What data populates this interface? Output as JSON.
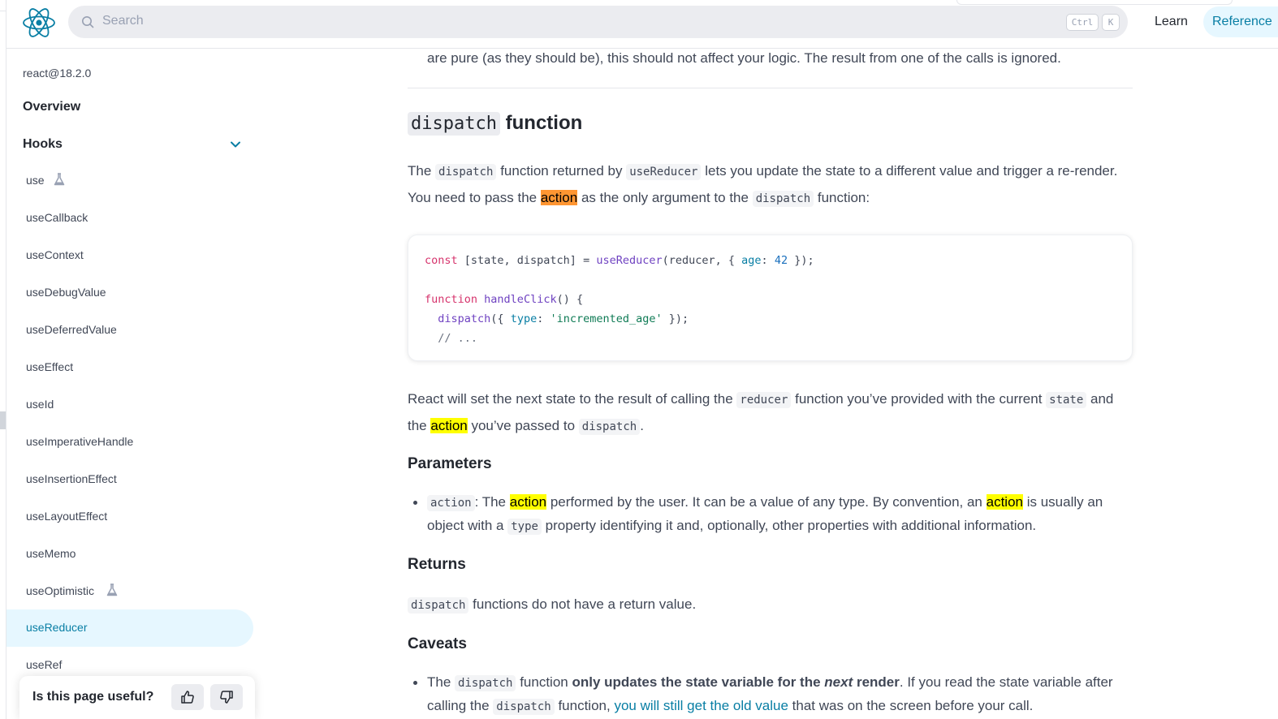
{
  "header": {
    "search_placeholder": "Search",
    "kbd_ctrl": "Ctrl",
    "kbd_k": "K",
    "nav_learn": "Learn",
    "nav_reference": "Reference",
    "accent": "#087ea4"
  },
  "sidebar": {
    "version": "react@18.2.0",
    "overview": "Overview",
    "section": "Hooks",
    "items": [
      {
        "label": "use",
        "badge": "flask-icon"
      },
      {
        "label": "useCallback"
      },
      {
        "label": "useContext"
      },
      {
        "label": "useDebugValue"
      },
      {
        "label": "useDeferredValue"
      },
      {
        "label": "useEffect"
      },
      {
        "label": "useId"
      },
      {
        "label": "useImperativeHandle"
      },
      {
        "label": "useInsertionEffect"
      },
      {
        "label": "useLayoutEffect"
      },
      {
        "label": "useMemo"
      },
      {
        "label": "useOptimistic",
        "badge": "flask-icon"
      },
      {
        "label": "useReducer",
        "active": true
      },
      {
        "label": "useRef"
      }
    ],
    "feedback_question": "Is this page useful?"
  },
  "main": {
    "prev_text": "are pure (as they should be), this should not affect your logic. The result from one of the calls is ignored.",
    "heading_code": "dispatch",
    "heading_text": "function",
    "intro": {
      "t1": "The ",
      "c1": "dispatch",
      "t2": " function returned by ",
      "c2": "useReducer",
      "t3": " lets you update the state to a different value and trigger a re-render. You need to pass the ",
      "hl": "action",
      "t4": " as the only argument to the ",
      "c3": "dispatch",
      "t5": " function:"
    },
    "code": {
      "l1_kw": "const",
      "l1_a": " [state, dispatch] = ",
      "l1_fn": "useReducer",
      "l1_b": "(reducer, { ",
      "l1_prop": "age",
      "l1_c": ": ",
      "l1_num": "42",
      "l1_d": " });",
      "l3_kw": "function",
      "l3_fn": "handleClick",
      "l3_a": "() {",
      "l4_fn": "dispatch",
      "l4_a": "({ ",
      "l4_prop": "type",
      "l4_b": ": ",
      "l4_str": "'incremented_age'",
      "l4_c": " });",
      "l5_cm": "// ..."
    },
    "react_sets": {
      "t1": "React will set the next state to the result of calling the ",
      "c1": "reducer",
      "t2": " function you’ve provided with the current ",
      "c2": "state",
      "t3": " and the ",
      "hl": "action",
      "t4": " you’ve passed to ",
      "c3": "dispatch",
      "t5": "."
    },
    "parameters_heading": "Parameters",
    "param": {
      "c1": "action",
      "t1": ": The ",
      "hl1": "action",
      "t2": " performed by the user. It can be a value of any type. By convention, an ",
      "hl2": "action",
      "t3": " is usually an object with a ",
      "c2": "type",
      "t4": " property identifying it and, optionally, other properties with additional information."
    },
    "returns_heading": "Returns",
    "returns": {
      "c1": "dispatch",
      "t1": " functions do not have a return value."
    },
    "caveats_heading": "Caveats",
    "caveat": {
      "t1": "The ",
      "c1": "dispatch",
      "t2": " function ",
      "b1": "only updates the state variable for the ",
      "i1": "next",
      "b2": " render",
      "t3": ". If you read the state variable after calling the ",
      "c2": "dispatch",
      "t4": " function, ",
      "link": "you will still get the old value",
      "t5": " that was on the screen before your call."
    }
  }
}
